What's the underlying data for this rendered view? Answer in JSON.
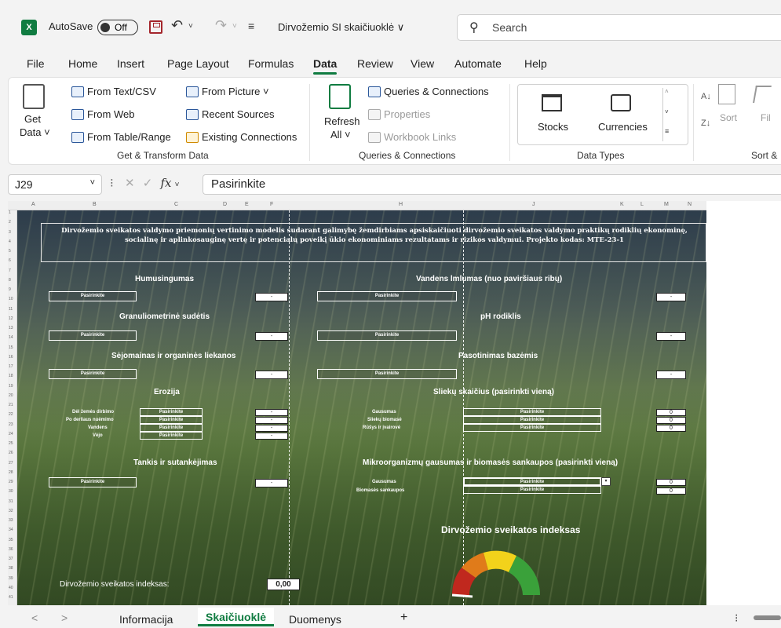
{
  "titlebar": {
    "app_logo": "X",
    "autosave_label": "AutoSave",
    "autosave_state": "Off",
    "doc_title": "Dirvožemio SI skaičiuoklė ∨",
    "search_placeholder": "Search"
  },
  "menu": [
    "File",
    "Home",
    "Insert",
    "Page Layout",
    "Formulas",
    "Data",
    "Review",
    "View",
    "Automate",
    "Help"
  ],
  "menu_active": "Data",
  "ribbon": {
    "get_data_line1": "Get",
    "get_data_line2": "Data ˅",
    "from_text_csv": "From Text/CSV",
    "from_web": "From Web",
    "from_table_range": "From Table/Range",
    "from_picture": "From Picture ˅",
    "recent_sources": "Recent Sources",
    "existing_connections": "Existing Connections",
    "group_get_transform": "Get & Transform Data",
    "refresh_line1": "Refresh",
    "refresh_line2": "All ˅",
    "queries_connections": "Queries & Connections",
    "properties": "Properties",
    "workbook_links": "Workbook Links",
    "group_queries": "Queries & Connections",
    "stocks": "Stocks",
    "currencies": "Currencies",
    "group_data_types": "Data Types",
    "sort": "Sort",
    "filter_partial": "Fil",
    "group_sort_partial": "Sort &"
  },
  "formula_bar": {
    "name_box": "J29",
    "fx": "fx",
    "value": "Pasirinkite"
  },
  "sheet": {
    "header_text": "Dirvožemio sveikatos valdymo priemonių vertinimo modelis sudarant galimybę žemdirbiams apsiskaičiuoti dirvožemio sveikatos valdymo praktikų rodiklių ekonominę, socialinę ir aplinkosauginę vertę ir potencialų poveikį ūkio ekonominiams rezultatams ir rizikos valdymui. Projekto kodas: MTE-23-1",
    "left": {
      "humusingumas": "Humusingumas",
      "granul": "Granuliometrinė sudėtis",
      "sejomainas": "Sėjomainas ir organinės liekanos",
      "erozija": "Erozija",
      "erozija_rows": [
        "Dėl žemės dirbimo",
        "Po derliaus nuėmimo",
        "Vandens",
        "Vėjo"
      ],
      "tankis": "Tankis ir sutankėjimas",
      "index_label": "Dirvožemio sveikatos indeksas:",
      "index_value": "0,00"
    },
    "right": {
      "vandens": "Vandens lmlumas (nuo paviršiaus ribų)",
      "ph": "pH rodiklis",
      "pasotinimas": "Pasotinimas bazėmis",
      "sliekai": "Sliekų skaičius (pasirinkti vieną)",
      "sliekai_rows": [
        "Gausumas",
        "Sliekų biomasė",
        "Rūšys ir įvairovė"
      ],
      "mikro": "Mikroorganizmų gausumas ir biomasės sankaupos (pasirinkti vieną)",
      "mikro_rows": [
        "Gausumas",
        "Biomasės sankaupos"
      ],
      "gauge_title": "Dirvožemio sveikatos indeksas"
    },
    "pick_label": "Pasirinkite",
    "empty_val": "-",
    "zero_val": "0"
  },
  "tabs": [
    "Informacija",
    "Skaičiuoklė",
    "Duomenys"
  ],
  "tab_active": "Skaičiuoklė",
  "add_sheet": "+",
  "colors": {
    "excel_green": "#107c41",
    "gauge_red": "#c0281e",
    "gauge_orange": "#e07b1a",
    "gauge_yellow": "#f2d21b",
    "gauge_green": "#3aa13a"
  }
}
